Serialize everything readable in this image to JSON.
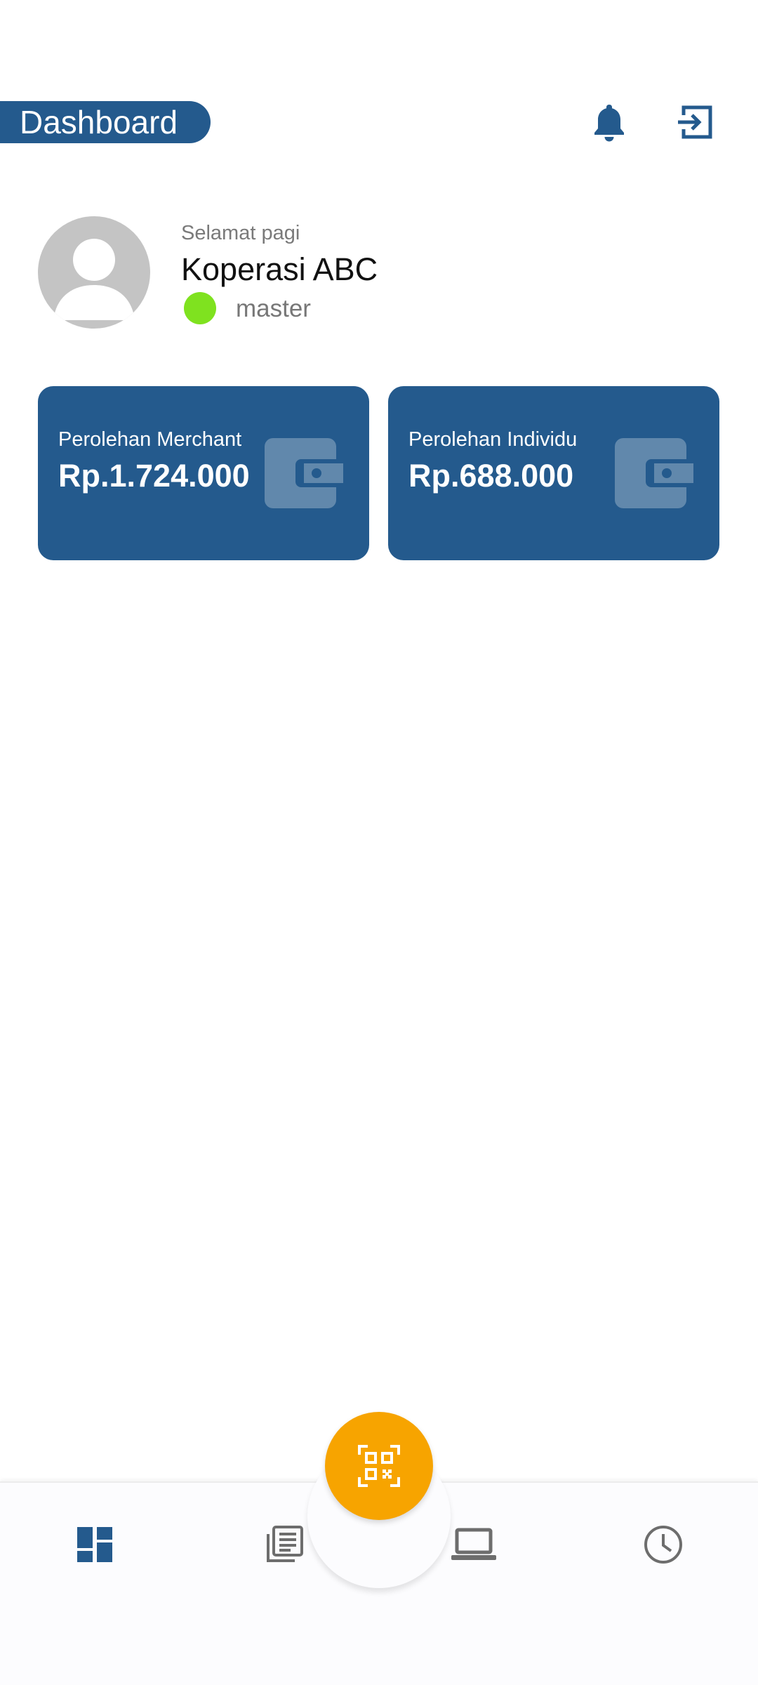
{
  "header": {
    "title": "Dashboard",
    "icons": [
      "bell-icon",
      "logout-icon"
    ]
  },
  "profile": {
    "greeting": "Selamat pagi",
    "name": "Koperasi ABC",
    "role": "master",
    "status_color": "#7fe21f"
  },
  "cards": [
    {
      "label": "Perolehan Merchant",
      "value": "Rp.1.724.000",
      "icon": "wallet-icon"
    },
    {
      "label": "Perolehan Individu",
      "value": "Rp.688.000",
      "icon": "wallet-icon"
    }
  ],
  "bottom_nav": {
    "items": [
      {
        "icon": "dashboard-icon",
        "active": true
      },
      {
        "icon": "news-icon",
        "active": false
      },
      {
        "icon": "laptop-icon",
        "active": false
      },
      {
        "icon": "history-icon",
        "active": false
      }
    ],
    "fab_icon": "qr-scan-icon"
  },
  "colors": {
    "primary": "#245a8d",
    "accent": "#f7a400",
    "status_online": "#7fe21f",
    "inactive_icon": "#6d6d6d"
  }
}
